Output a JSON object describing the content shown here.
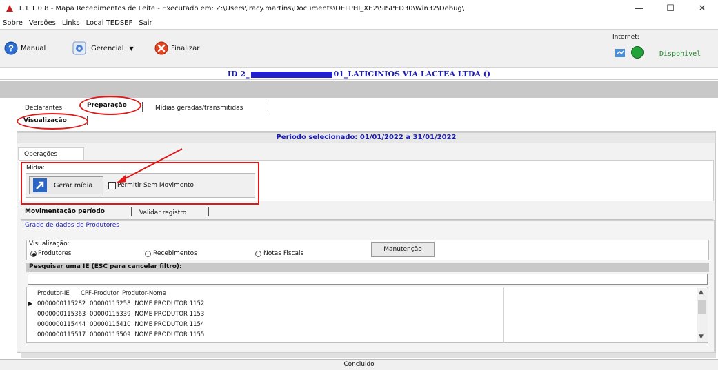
{
  "window": {
    "title": "1.1.1.0 8 - Mapa Recebimentos de Leite - Executado em: Z:\\Users\\iracy.martins\\Documents\\DELPHI_XE2\\SISPED30\\Win32\\Debug\\",
    "minimize": "—",
    "maximize": "☐",
    "close": "✕"
  },
  "menu": [
    "Sobre",
    "Versões",
    "Links",
    "Local TEDSEF",
    "Sair"
  ],
  "toolbar": {
    "manual_label": "Manual",
    "gerencial_label": "Gerencial",
    "finalizar_label": "Finalizar",
    "internet_label": "Internet:",
    "internet_status": "Disponivel"
  },
  "id_bar": {
    "prefix": "ID 2_",
    "suffix": "01_LATICINIOS VIA LACTEA LTDA ()"
  },
  "main_tabs": [
    "Declarantes",
    "Preparação",
    "Mídias geradas/transmitidas"
  ],
  "sub_tab": "Visualização",
  "periodo": "Periodo selecionado: 01/01/2022 a 31/01/2022",
  "operacoes_tab": "Operações",
  "midia": {
    "group_label": "Mídia:",
    "gerar_button": "Gerar mídia",
    "checkbox_label": "Permitir Sem Movimento",
    "checked": false
  },
  "inner_tabs": [
    "Movimentação período",
    "Validar registro"
  ],
  "grade_label": "Grade de dados de Produtores",
  "visualizacao": {
    "label": "Visualização:",
    "options": [
      "Produtores",
      "Recebimentos",
      "Notas Fiscais"
    ],
    "selected": "Produtores",
    "manutencao_button": "Manutenção"
  },
  "search": {
    "label": "Pesquisar uma IE (ESC para cancelar filtro):",
    "value": ""
  },
  "table": {
    "headers": [
      "Produtor-IE",
      "CPF-Produtor",
      "Produtor-Nome"
    ],
    "rows": [
      [
        "0000000115282",
        "00000115258",
        "NOME PRODUTOR 1152"
      ],
      [
        "0000000115363",
        "00000115339",
        "NOME PRODUTOR 1153"
      ],
      [
        "0000000115444",
        "00000115410",
        "NOME PRODUTOR 1154"
      ],
      [
        "0000000115517",
        "00000115509",
        "NOME PRODUTOR 1155"
      ]
    ],
    "current_row_marker": "▶"
  },
  "status": "Concluido",
  "colors": {
    "highlight_red": "#e01818",
    "title_blue": "#1a1ab4",
    "status_green": "#22a33a"
  }
}
